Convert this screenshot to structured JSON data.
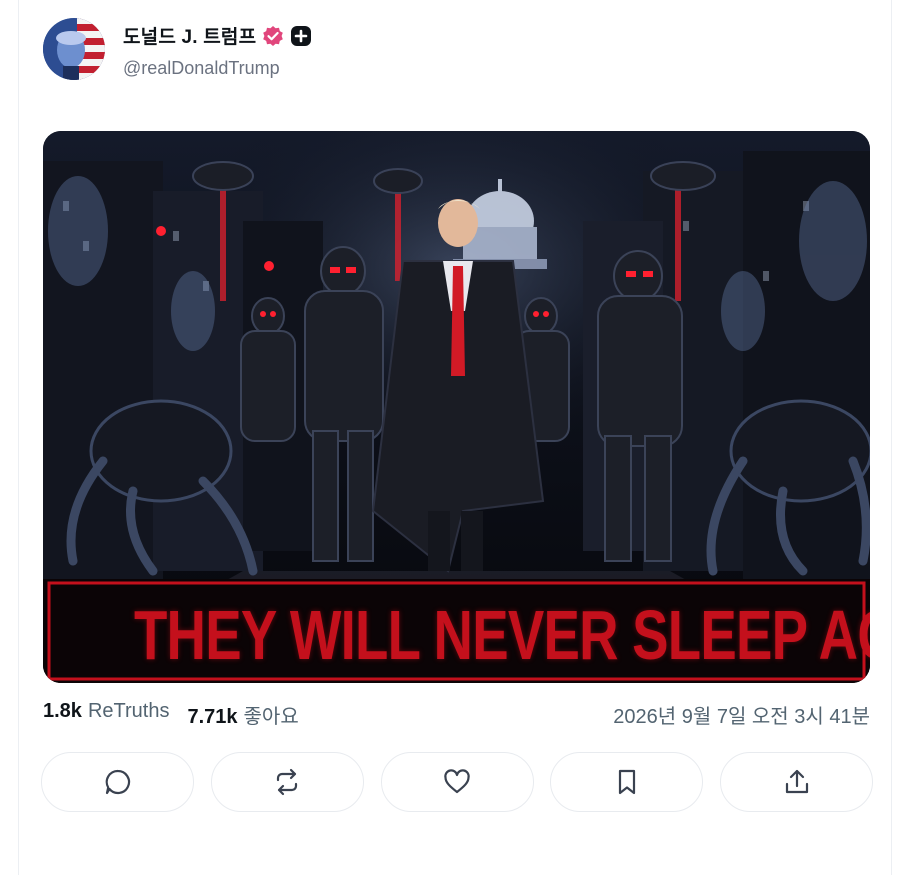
{
  "post": {
    "author": {
      "display_name": "도널드 J. 트럼프",
      "handle": "@realDonaldTrump",
      "verified": true,
      "badge_icon": "verified-icon",
      "plus_icon": "plus-badge-icon"
    },
    "media": {
      "banner_text": "THEY WILL NEVER SLEEP AGAIN."
    },
    "stats": {
      "retruths_count": "1.8k",
      "retruths_label": "ReTruths",
      "likes_count": "7.71k",
      "likes_label": "좋아요",
      "timestamp": "2026년 9월 7일 오전 3시 41분"
    },
    "actions": [
      {
        "name": "reply",
        "icon": "comment-icon"
      },
      {
        "name": "retruth",
        "icon": "repost-icon"
      },
      {
        "name": "like",
        "icon": "heart-icon"
      },
      {
        "name": "bookmark",
        "icon": "bookmark-icon"
      },
      {
        "name": "share",
        "icon": "share-icon"
      }
    ]
  },
  "colors": {
    "verified": "#e1467c",
    "banner_red": "#c4101c",
    "muted_text": "#536471"
  }
}
